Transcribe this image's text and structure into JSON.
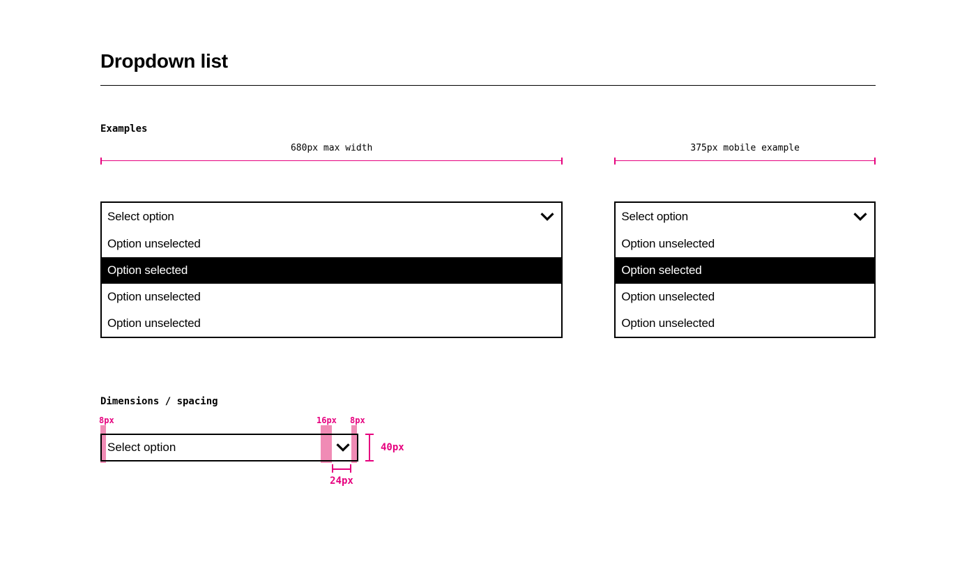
{
  "page": {
    "title": "Dropdown list"
  },
  "sections": {
    "examples_label": "Examples",
    "dimensions_label": "Dimensions / spacing"
  },
  "measurements": {
    "max_width_label": "680px max width",
    "mobile_label": "375px mobile example",
    "left_pad": "8px",
    "icon_gap": "16px",
    "right_pad": "8px",
    "height_label": "40px",
    "icon_width_label": "24px"
  },
  "dropdown": {
    "placeholder": "Select option",
    "options": {
      "unselected_1": "Option unselected",
      "selected": "Option selected",
      "unselected_2": "Option unselected",
      "unselected_3": "Option unselected"
    }
  },
  "colors": {
    "accent": "#E6007E",
    "accent_soft": "#F08BB5",
    "black": "#000000",
    "white": "#FFFFFF"
  }
}
